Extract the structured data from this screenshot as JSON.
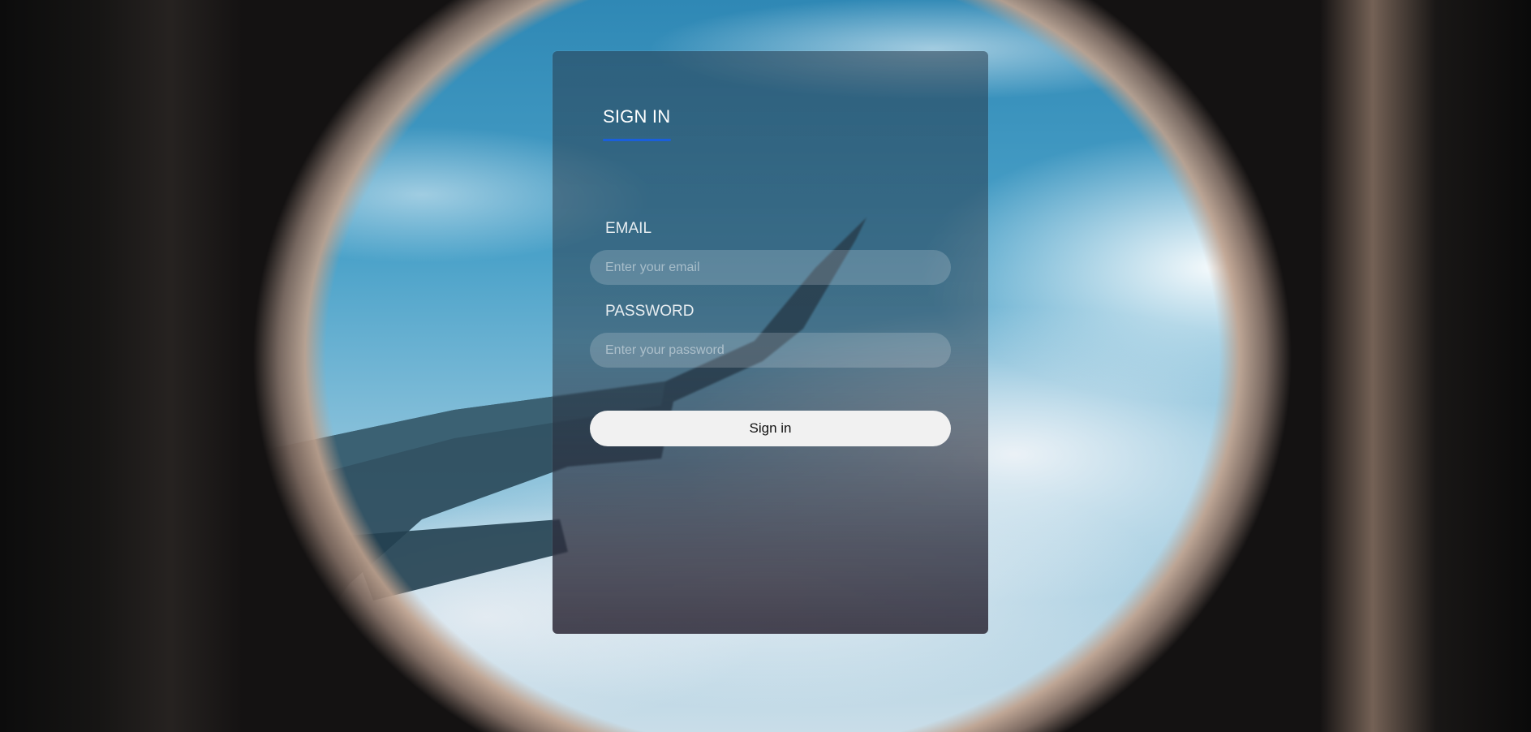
{
  "login": {
    "title": "SIGN IN",
    "email_label": "EMAIL",
    "email_placeholder": "Enter your email",
    "email_value": "",
    "password_label": "PASSWORD",
    "password_placeholder": "Enter your password",
    "password_value": "",
    "submit_label": "Sign in"
  },
  "colors": {
    "accent": "#1a5fdc",
    "button_bg": "#f1f1f1"
  }
}
